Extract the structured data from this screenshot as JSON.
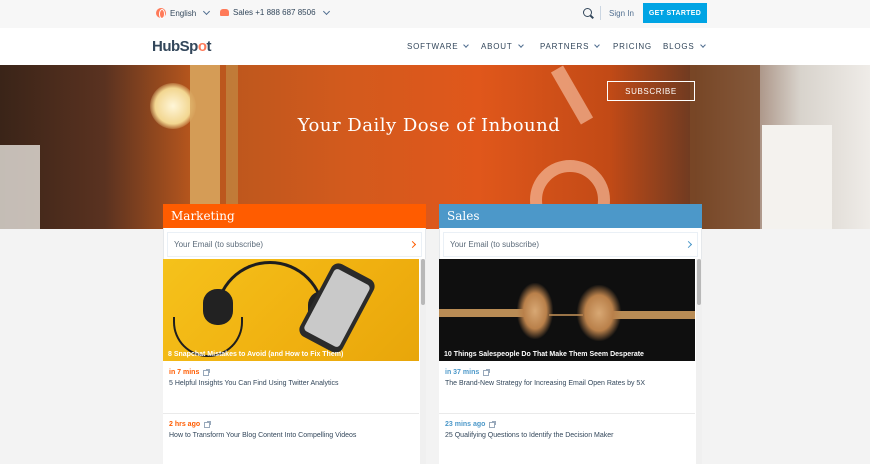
{
  "utility": {
    "language": "English",
    "sales": "Sales +1 888 687 8506",
    "signin": "Sign In",
    "get_started": "GET STARTED"
  },
  "nav": {
    "logo": "HubSpot",
    "items": [
      "SOFTWARE",
      "ABOUT",
      "PARTNERS",
      "PRICING",
      "BLOGS"
    ]
  },
  "hero": {
    "title": "Your Daily Dose of Inbound",
    "subscribe": "SUBSCRIBE"
  },
  "colors": {
    "marketing": "#ff5c00",
    "sales": "#4c98c9",
    "accent": "#ff7a59",
    "cta": "#00a4e4"
  },
  "cards": [
    {
      "title": "Marketing",
      "email_placeholder": "Your Email (to subscribe)",
      "feature_title": "8 Snapchat Mistakes to Avoid (and How to Fix Them)",
      "posts": [
        {
          "time": "in 7 mins",
          "title": "5 Helpful Insights You Can Find Using Twitter Analytics"
        },
        {
          "time": "2 hrs ago",
          "title": "How to Transform Your Blog Content Into Compelling Videos"
        }
      ]
    },
    {
      "title": "Sales",
      "email_placeholder": "Your Email (to subscribe)",
      "feature_title": "10 Things Salespeople Do That Make Them Seem Desperate",
      "posts": [
        {
          "time": "in 37 mins",
          "title": "The Brand-New Strategy for Increasing Email Open Rates by 5X"
        },
        {
          "time": "23 mins ago",
          "title": "25 Qualifying Questions to Identify the Decision Maker"
        }
      ]
    }
  ]
}
